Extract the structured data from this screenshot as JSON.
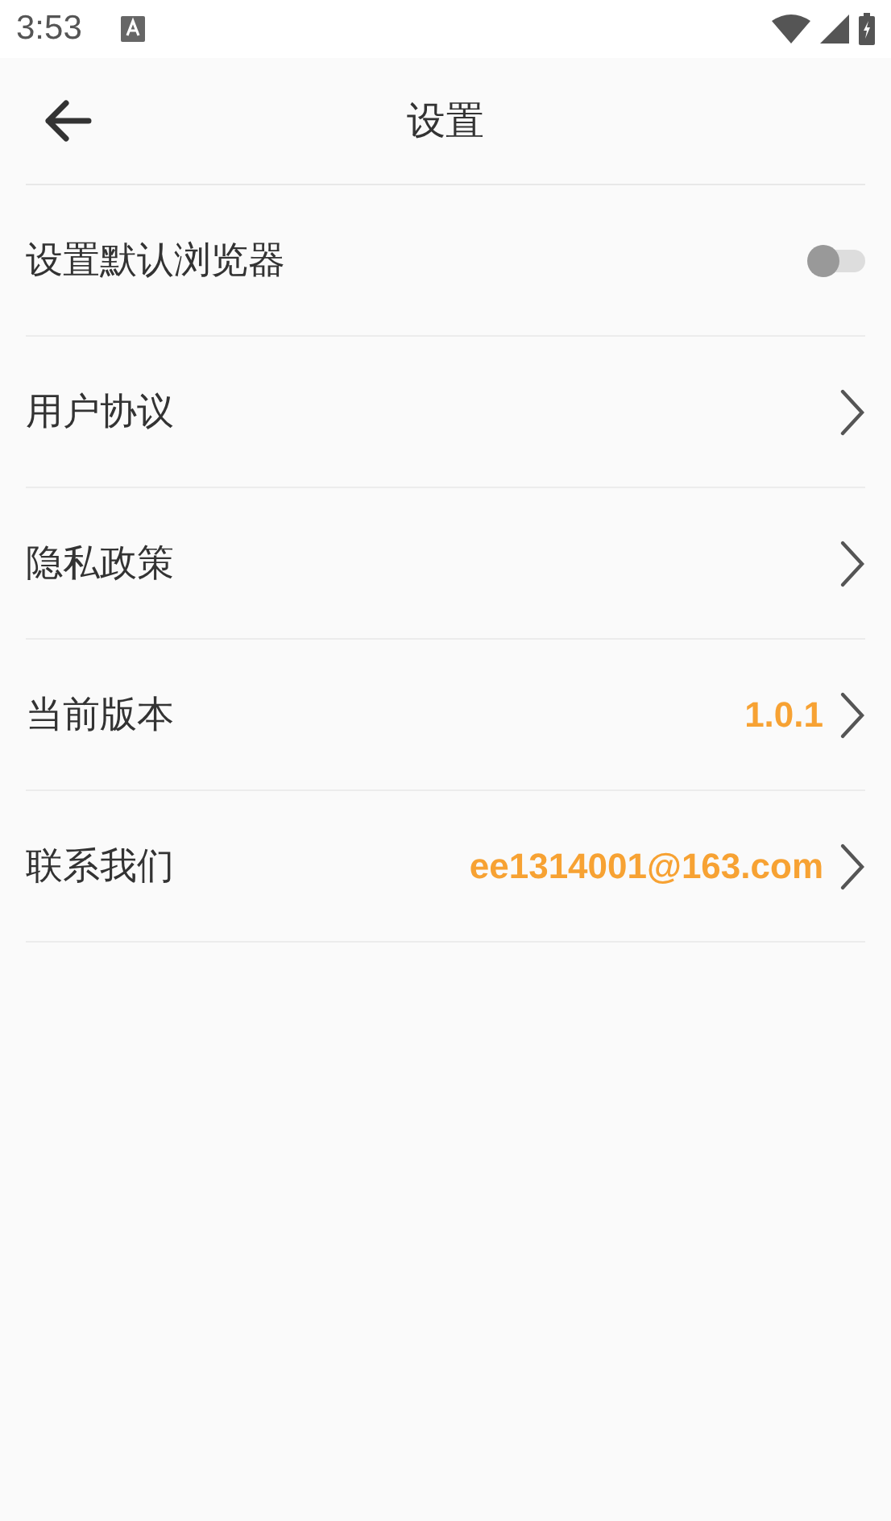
{
  "status_bar": {
    "time": "3:53"
  },
  "header": {
    "title": "设置"
  },
  "items": [
    {
      "kind": "toggle",
      "label": "设置默认浏览器",
      "on": false
    },
    {
      "kind": "link",
      "label": "用户协议"
    },
    {
      "kind": "link",
      "label": "隐私政策"
    },
    {
      "kind": "link",
      "label": "当前版本",
      "value": "1.0.1"
    },
    {
      "kind": "link",
      "label": "联系我们",
      "value": "ee1314001@163.com"
    }
  ]
}
